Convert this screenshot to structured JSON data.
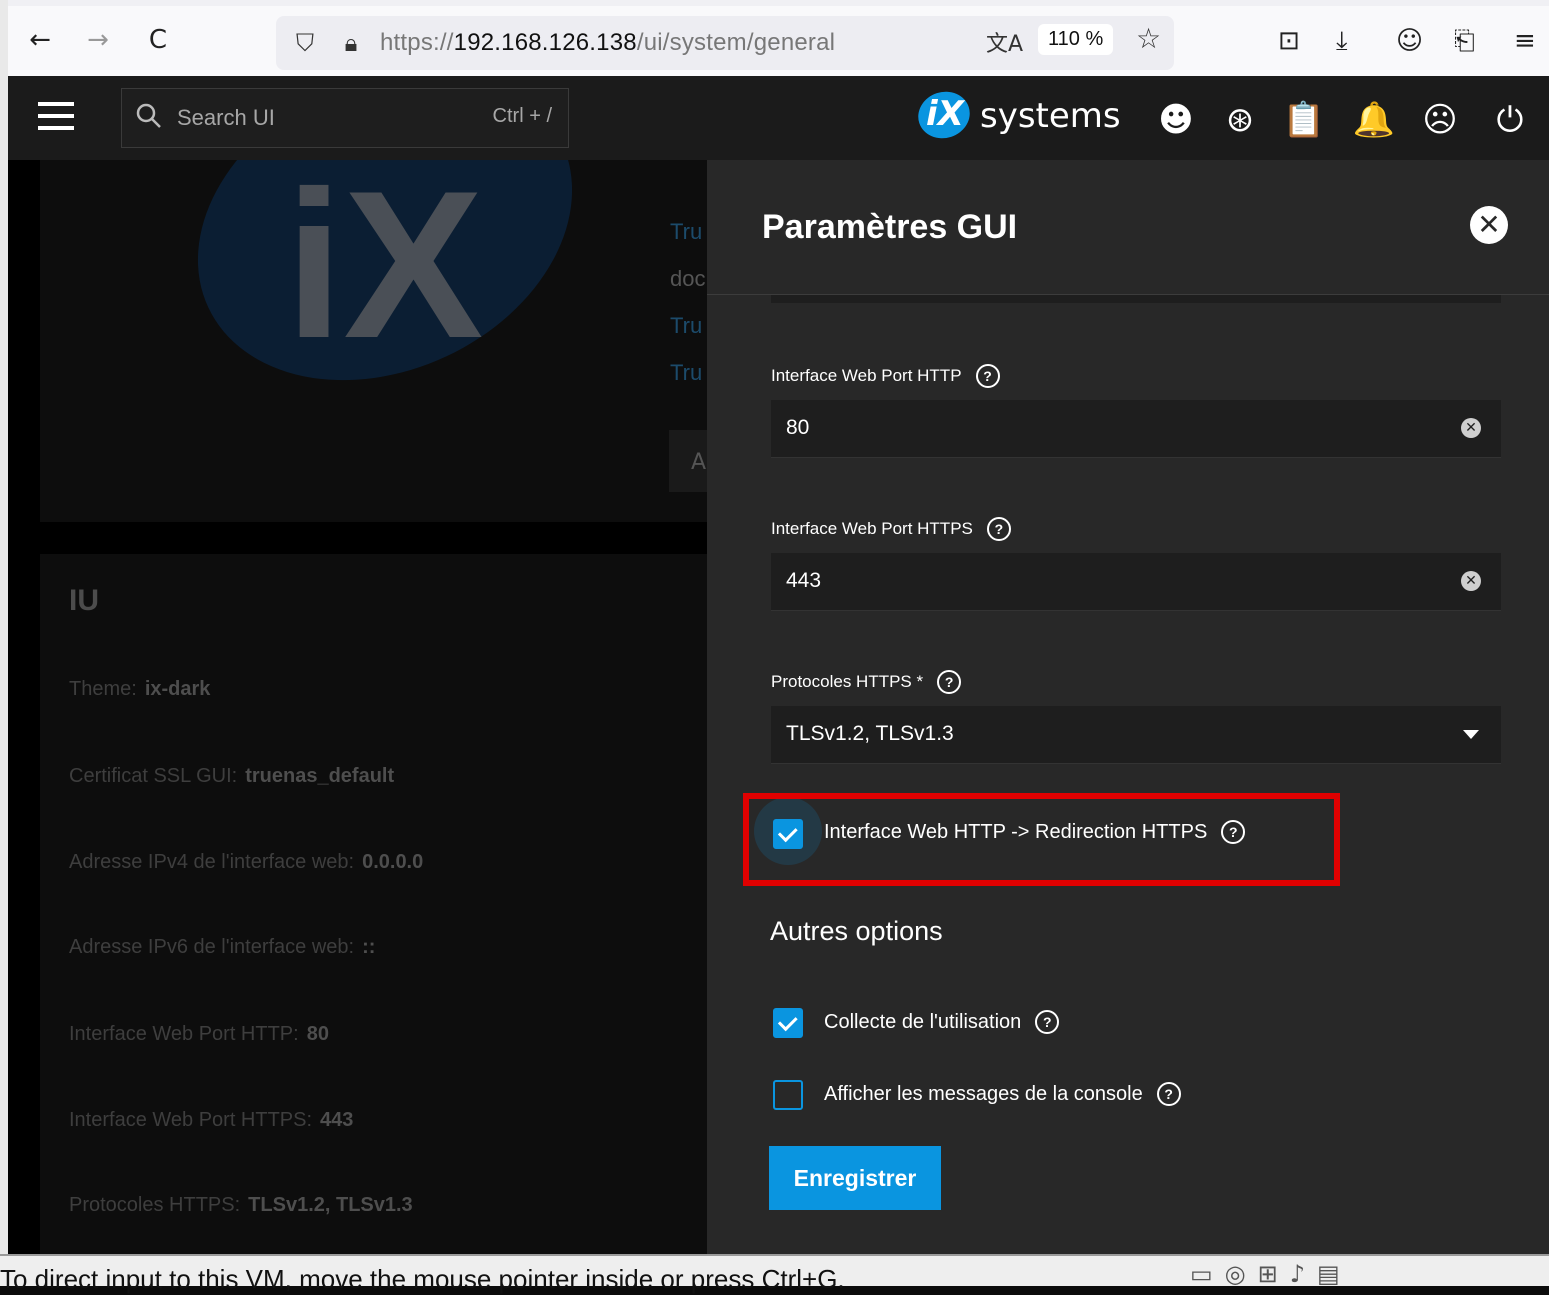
{
  "browser": {
    "back": "←",
    "forward": "→",
    "reload": "C",
    "url_prefix": "https://",
    "url_host": "192.168.126.138",
    "url_path": "/ui/system/general",
    "zoom": "110 %",
    "translate_glyph": "文A",
    "star_glyph": "☆",
    "right_icons": [
      "⊡",
      "⤓",
      "☺",
      "⎗",
      "≡"
    ]
  },
  "topbar": {
    "search_placeholder": "Search UI",
    "search_shortcut": "Ctrl + /",
    "logo_mark": "iX",
    "logo_text": "systems",
    "icons": [
      "☻",
      "⊛",
      "📋",
      "🔔",
      "☹",
      "⏻"
    ]
  },
  "background_page": {
    "link_lines": [
      "Tru",
      "doc",
      "Tru",
      "Tru"
    ],
    "button_stub": "A",
    "ui_card_title": "IU",
    "rows": [
      {
        "label": "Theme:",
        "value": "ix-dark"
      },
      {
        "label": "Certificat SSL GUI:",
        "value": "truenas_default"
      },
      {
        "label": "Adresse IPv4 de l'interface web:",
        "value": "0.0.0.0"
      },
      {
        "label": "Adresse IPv6 de l'interface web:",
        "value": "::"
      },
      {
        "label": "Interface Web Port HTTP:",
        "value": "80"
      },
      {
        "label": "Interface Web Port HTTPS:",
        "value": "443"
      },
      {
        "label": "Protocoles HTTPS:",
        "value": "TLSv1.2, TLSv1.3"
      }
    ]
  },
  "panel": {
    "title": "Paramètres GUI",
    "close_glyph": "✕",
    "http_port": {
      "label": "Interface Web Port HTTP",
      "value": "80"
    },
    "https_port": {
      "label": "Interface Web Port HTTPS",
      "value": "443"
    },
    "https_protocols": {
      "label": "Protocoles HTTPS *",
      "value": "TLSv1.2, TLSv1.3"
    },
    "redirect": {
      "label": "Interface Web HTTP -> Redirection HTTPS",
      "checked": true
    },
    "other_options_title": "Autres options",
    "usage_collection": {
      "label": "Collecte de l'utilisation",
      "checked": true
    },
    "console_messages": {
      "label": "Afficher les messages de la console",
      "checked": false
    },
    "save_label": "Enregistrer",
    "help_glyph": "?",
    "clear_glyph": "✕"
  },
  "vm_status": {
    "message": "To direct input to this VM, move the mouse pointer inside or press Ctrl+G."
  },
  "colors": {
    "accent": "#0a95e0",
    "highlight": "#e00000",
    "panel_bg": "#282828",
    "topbar_bg": "#1b1b1b"
  }
}
